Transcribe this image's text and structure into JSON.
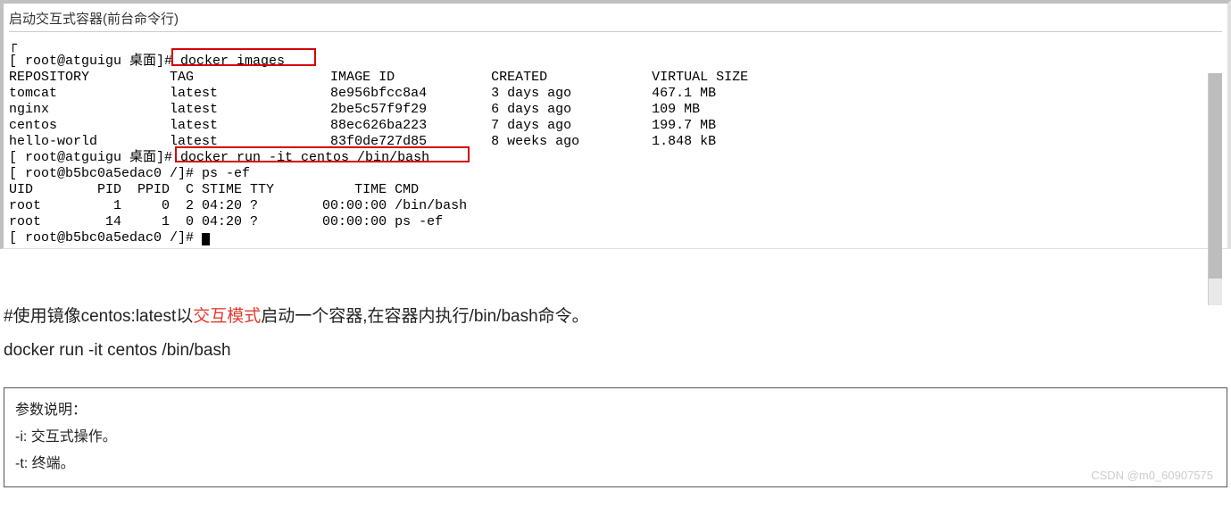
{
  "title": "启动交互式容器(前台命令行)",
  "terminal": {
    "line0": "┌",
    "prompt1_pre": "[ root@atguigu 桌面]#",
    "cmd1": " docker images",
    "header": "REPOSITORY          TAG                 IMAGE ID            CREATED             VIRTUAL SIZE",
    "row1": "tomcat              latest              8e956bfcc8a4        3 days ago          467.1 MB",
    "row2": "nginx               latest              2be5c57f9f29        6 days ago          109 MB",
    "row3": "centos              latest              88ec626ba223        7 days ago          199.7 MB",
    "row4": "hello-world         latest              83f0de727d85        8 weeks ago         1.848 kB",
    "prompt2_pre": "[ root@atguigu 桌面]# ",
    "cmd2": "docker run -it centos /bin/bash",
    "prompt3": "[ root@b5bc0a5edac0 /]# ps -ef",
    "psheader": "UID        PID  PPID  C STIME TTY          TIME CMD",
    "ps1": "root         1     0  2 04:20 ?        00:00:00 /bin/bash",
    "ps2": "root        14     1  0 04:20 ?        00:00:00 ps -ef",
    "prompt4": "[ root@b5bc0a5edac0 /]# "
  },
  "desc": {
    "pre": "#使用镜像centos:latest以",
    "mid": "交互模式",
    "post": "启动一个容器,在容器内执行/bin/bash命令。",
    "cmd": "docker run -it centos /bin/bash"
  },
  "params": {
    "title": "参数说明：",
    "i": "-i: 交互式操作。",
    "t": "-t: 终端。"
  },
  "watermark": "CSDN @m0_60907575"
}
